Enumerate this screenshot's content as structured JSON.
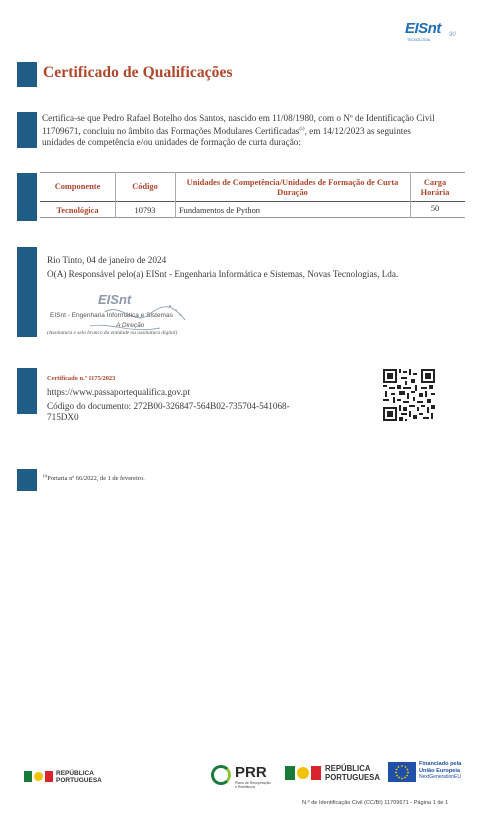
{
  "header": {
    "logo_text": "EISnt",
    "logo_sub": "90",
    "logo_tagline": "TECNOLOGIA"
  },
  "title": "Certificado de Qualificações",
  "intro": {
    "line1": "Certifica-se que Pedro Rafael Botelho dos Santos, nascido em 11/08/1980, com o Nº de Identificação Civil",
    "line2": "11709671, concluiu no âmbito das Formações Modulares Certificadas",
    "line2_sup": "(i)",
    "line2_end": ", em 14/12/2023 as seguintes",
    "line3": "unidades de competência e/ou unidades de formação de curta duração:"
  },
  "table": {
    "headers": {
      "componente": "Componente",
      "codigo": "Código",
      "unidades": "Unidades de Competência/Unidades de Formação de Curta Duração",
      "carga": "Carga Horária"
    },
    "rows": [
      {
        "componente": "Tecnológica",
        "codigo": "10793",
        "unidade": "Fundamentos de Python",
        "carga": "50"
      }
    ]
  },
  "signature": {
    "place_date": "Rio Tinto, 04 de janeiro de 2024",
    "responsible": "O(A) Responsável pelo(a) EISnt - Engenharia Informática e Sistemas, Novas Tecnologias, Lda.",
    "stamp_logo": "EISnt",
    "stamp_line1": "EISnt - Engenharia Informática e Sistemas",
    "stamp_line2": "A Direção",
    "caption": "(Assinatura e selo branco da entidade ou assinatura digital)"
  },
  "verification": {
    "cert_no": "Certificado n.º 1175/2023",
    "url": "https://www.passaportequalifica.gov.pt",
    "doc_code_line1": "Código do documento: 272B00-326847-564B02-735704-541068-",
    "doc_code_line2": "715DX0"
  },
  "footnote": {
    "mark": "(i)",
    "text": "Portaria nº 66/2022, de 1 de fevereiro."
  },
  "footer": {
    "rep_left": [
      "REPÚBLICA",
      "PORTUGUESA"
    ],
    "prr": "PRR",
    "prr_sub": [
      "Plano de Recuperação",
      "e Resiliência"
    ],
    "rep_mid": [
      "REPÚBLICA",
      "PORTUGUESA"
    ],
    "eu": [
      "Financiado pela",
      "União Europeia",
      "NextGenerationEU"
    ],
    "page_info": "N.º de Identificação Civil (CC/BI) 11709671  -  Página 1 de 1"
  },
  "colors": {
    "accent": "#b0452a",
    "bar": "#1f5d86",
    "brand_blue": "#1f6fb8"
  }
}
